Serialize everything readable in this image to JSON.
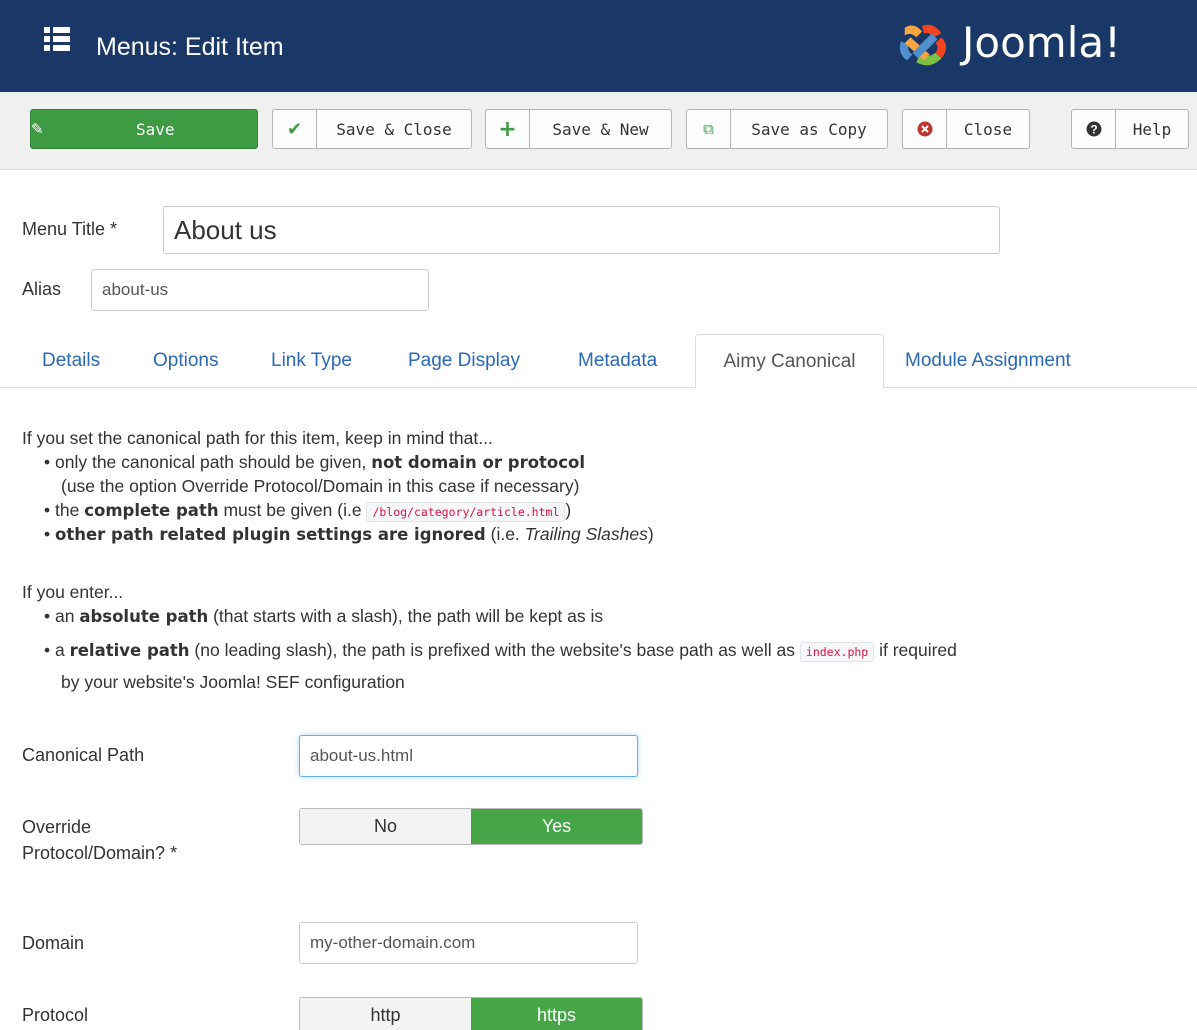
{
  "header": {
    "title": "Menus: Edit Item",
    "logo_text": "Joomla!"
  },
  "toolbar": {
    "save": "Save",
    "save_close": "Save & Close",
    "save_new": "Save & New",
    "save_copy": "Save as Copy",
    "close": "Close",
    "help": "Help"
  },
  "form": {
    "menu_title_label": "Menu Title *",
    "menu_title_value": "About us",
    "alias_label": "Alias",
    "alias_value": "about-us"
  },
  "tabs": [
    "Details",
    "Options",
    "Link Type",
    "Page Display",
    "Metadata",
    "Aimy Canonical",
    "Module Assignment"
  ],
  "active_tab": "Aimy Canonical",
  "info": {
    "intro": "If you set the canonical path for this item, keep in mind that...",
    "b1_pre": "only the canonical path should be given, ",
    "b1_bold": "not domain or protocol",
    "b1_line2": "(use the option Override Protocol/Domain in this case if necessary)",
    "b2_pre": "the ",
    "b2_bold": "complete path",
    "b2_post": " must be given (i.e ",
    "b2_code": "/blog/category/article.html",
    "b2_end": ")",
    "b3_bold": "other path related plugin settings are ignored",
    "b3_post": " (i.e. ",
    "b3_italic": "Trailing Slashes",
    "b3_end": ")",
    "enter": "If you enter...",
    "e1_pre": "an ",
    "e1_bold": "absolute path",
    "e1_post": " (that starts with a slash), the path will be kept as is",
    "e2_pre": "a ",
    "e2_bold": "relative path",
    "e2_post": " (no leading slash), the path is prefixed with the website's base path as well as ",
    "e2_code": "index.php",
    "e2_end": " if required",
    "e2_line2": "by your website's Joomla! SEF configuration"
  },
  "fields": {
    "canonical_label": "Canonical Path",
    "canonical_value": "about-us.html",
    "override_label_1": "Override",
    "override_label_2": "Protocol/Domain? *",
    "override_no": "No",
    "override_yes": "Yes",
    "override_selected": "Yes",
    "domain_label": "Domain",
    "domain_value": "my-other-domain.com",
    "protocol_label": "Protocol",
    "protocol_http": "http",
    "protocol_https": "https",
    "protocol_selected": "https"
  },
  "colors": {
    "header_bg": "#1a3867",
    "save_green": "#3e9b44",
    "toggle_on": "#46a546",
    "link_blue": "#2a69b8"
  },
  "icons": [
    "list-menu-icon",
    "joomla-logo-icon",
    "edit-icon",
    "check-icon",
    "plus-icon",
    "copy-icon",
    "close-circle-icon",
    "question-circle-icon"
  ]
}
